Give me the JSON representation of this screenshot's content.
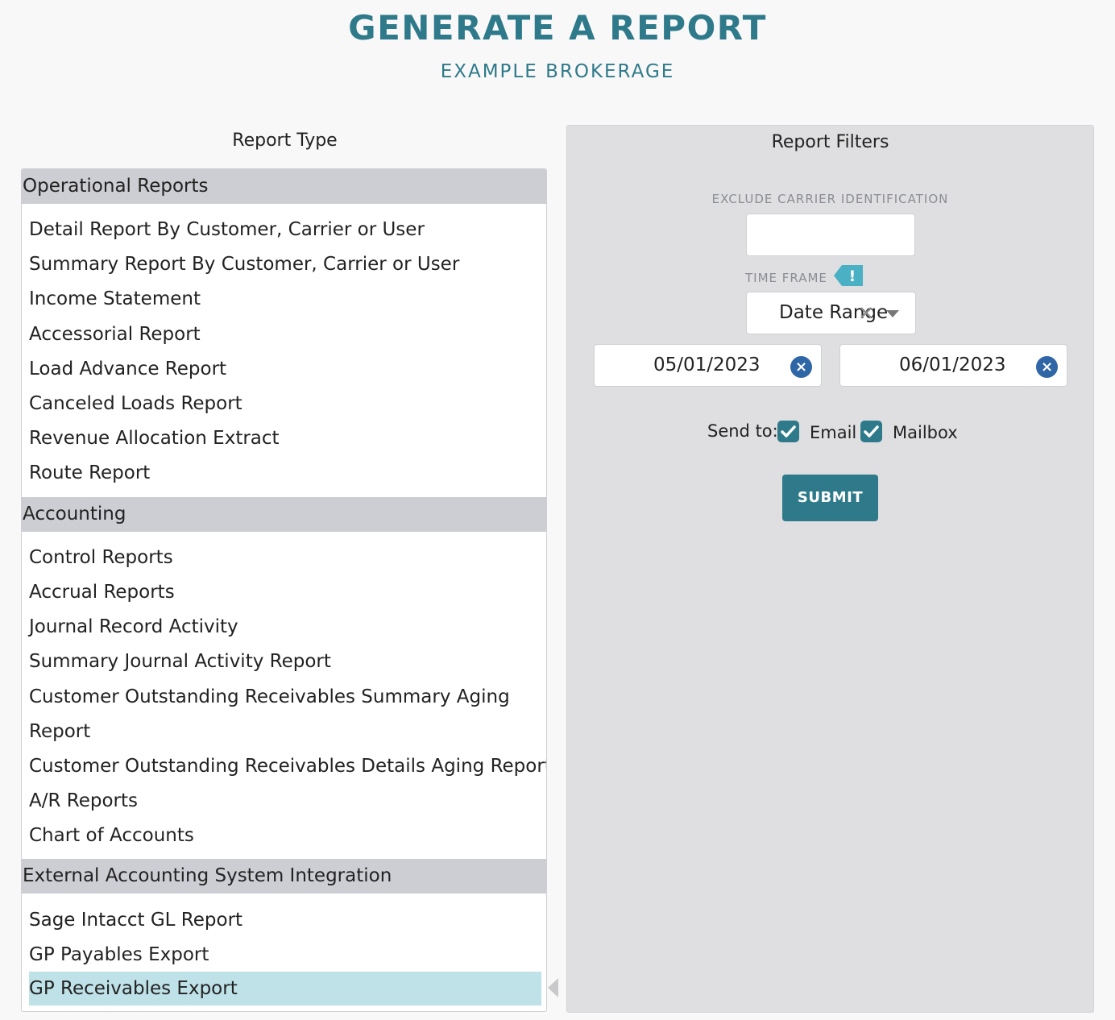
{
  "header": {
    "title": "GENERATE A REPORT",
    "subtitle": "EXAMPLE BROKERAGE"
  },
  "report_type": {
    "heading": "Report Type",
    "sections": [
      {
        "title": "Operational Reports",
        "items": [
          "Detail Report By Customer, Carrier or User",
          "Summary Report By Customer, Carrier or User",
          "Income Statement",
          "Accessorial Report",
          "Load Advance Report",
          "Canceled Loads Report",
          "Revenue Allocation Extract",
          "Route Report"
        ]
      },
      {
        "title": "Accounting",
        "items": [
          "Control Reports",
          "Accrual Reports",
          "Journal Record Activity",
          "Summary Journal Activity Report",
          "Customer Outstanding Receivables Summary Aging Report",
          "Customer Outstanding Receivables Details Aging Report",
          "A/R Reports",
          "Chart of Accounts"
        ]
      },
      {
        "title": "External Accounting System Integration",
        "items": [
          "Sage Intacct GL Report",
          "GP Payables Export",
          "GP Receivables Export"
        ]
      }
    ],
    "selected_item": "GP Receivables Export"
  },
  "filters": {
    "heading": "Report Filters",
    "exclude_carrier": {
      "label": "EXCLUDE CARRIER IDENTIFICATION",
      "value": ""
    },
    "time_frame": {
      "label": "TIME FRAME",
      "badge": "!",
      "value": "Date Range",
      "clear_glyph": "✕"
    },
    "start_date": "05/01/2023",
    "end_date": "06/01/2023",
    "date_clear_glyph": "×",
    "send_to": {
      "label": "Send to:",
      "options": [
        {
          "label": "Email",
          "checked": true
        },
        {
          "label": "Mailbox",
          "checked": true
        }
      ]
    },
    "submit_label": "SUBMIT"
  },
  "colors": {
    "accent": "#2f7a8a",
    "section_header_bg": "#cdced3",
    "selected_bg": "#bfe1e8",
    "panel_bg": "#dfdfe1",
    "date_clear_bg": "#2f66a6",
    "badge_bg": "#4ab0c4"
  }
}
